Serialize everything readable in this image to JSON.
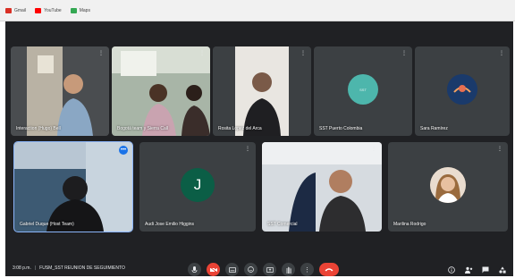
{
  "bookmarks": [
    {
      "label": "Gmail",
      "color": "#d93025"
    },
    {
      "label": "YouTube",
      "color": "#ff0000"
    },
    {
      "label": "Maps",
      "color": "#34a853"
    }
  ],
  "participants": [
    {
      "name": "Interaction (Hugo) Bell",
      "type": "video"
    },
    {
      "name": "Bogotá team y Sierra Call",
      "type": "video"
    },
    {
      "name": "Rosita Lopez del Arca",
      "type": "video"
    },
    {
      "name": "SST Puerto Colombia",
      "type": "logo",
      "color": "#4db6ac"
    },
    {
      "name": "Sara Ramírez",
      "type": "logo",
      "color": "#1a3a6b"
    },
    {
      "name": "Gabriel Duque (Host Team)",
      "type": "video",
      "active": true
    },
    {
      "name": "Audi Jose Emilio Higgins",
      "type": "avatar",
      "initial": "J",
      "color": "#0b5e46"
    },
    {
      "name": "SST Comercial",
      "type": "video"
    },
    {
      "name": "Marilina Rodrigo",
      "type": "photo"
    }
  ],
  "controls": {
    "time": "3:08 p.m.",
    "meeting_title": "FUSM_SST REUNION DE SEGUIMIENTO"
  },
  "colors": {
    "background": "#202124",
    "tile": "#3c4043",
    "accent": "#8ab4f8",
    "danger": "#ea4335"
  },
  "icons": {
    "mic": "microphone-icon",
    "camera": "camera-off-icon",
    "captions": "captions-icon",
    "emoji": "emoji-icon",
    "present": "present-icon",
    "hand": "raise-hand-icon",
    "more": "more-options-icon",
    "hangup": "hangup-icon",
    "info": "info-icon",
    "people": "people-icon",
    "chat": "chat-icon",
    "activities": "activities-icon"
  }
}
